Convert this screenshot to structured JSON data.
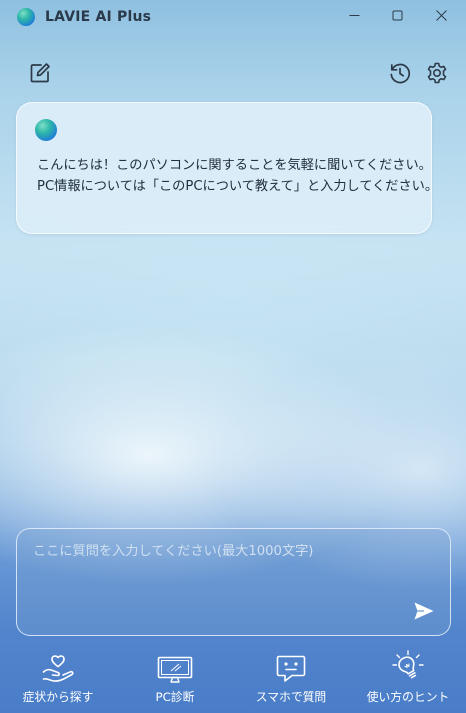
{
  "window": {
    "title": "LAVIE AI Plus",
    "controls": {
      "minimize": "—",
      "maximize": "☐",
      "close": "✕"
    }
  },
  "toolbar": {
    "new_chat_icon": "edit-icon",
    "history_icon": "history-icon",
    "settings_icon": "gear-icon"
  },
  "assistant_message": {
    "line1": "こんにちは！このパソコンに関することを気軽に聞いてください。",
    "line2": "PC情報については「このPCについて教えて」と入力してください。"
  },
  "input": {
    "placeholder": "ここに質問を入力してください(最大1000文字)",
    "value": ""
  },
  "bottom_nav": {
    "items": [
      {
        "label": "症状から探す",
        "icon": "hand-heart-icon"
      },
      {
        "label": "PC診断",
        "icon": "monitor-icon"
      },
      {
        "label": "スマホで質問",
        "icon": "chat-bubble-icon"
      },
      {
        "label": "使い方のヒント",
        "icon": "lightbulb-icon"
      }
    ]
  },
  "colors": {
    "text_dark": "#22303e",
    "nav_text": "#ffffff",
    "placeholder": "#cfe0f0"
  }
}
